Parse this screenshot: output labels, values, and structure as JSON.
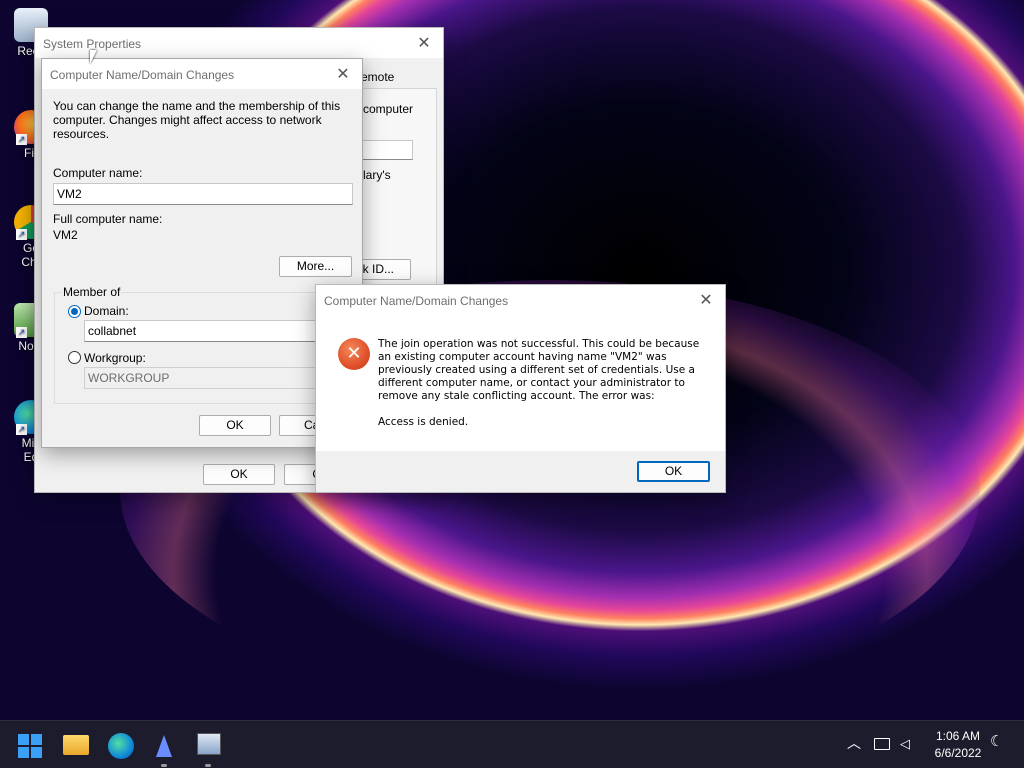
{
  "desktop": {
    "icons": [
      {
        "label": "Recy",
        "icon": "recycle-bin-icon"
      },
      {
        "label": "Fir",
        "icon": "firefox-icon"
      },
      {
        "label": "Go\nChr",
        "icon": "chrome-icon"
      },
      {
        "label": "Note",
        "icon": "notepad-icon"
      },
      {
        "label": "Mic\nEd",
        "icon": "edge-icon"
      }
    ]
  },
  "system_properties": {
    "title": "System Properties",
    "close_glyph": "✕",
    "partial_tab": "emote",
    "partial_text_1": "computer",
    "partial_text_2": "lary's",
    "partial_button": "ork ID...",
    "ok_label": "OK",
    "cancel_label": "Ca"
  },
  "name_changes": {
    "title": "Computer Name/Domain Changes",
    "close_glyph": "✕",
    "intro": "You can change the name and the membership of this computer. Changes might affect access to network resources.",
    "computer_name_label": "Computer name:",
    "computer_name_value": "VM2",
    "full_name_label": "Full computer name:",
    "full_name_value": "VM2",
    "more_label": "More...",
    "member_of_label": "Member of",
    "domain_label": "Domain:",
    "domain_value": "collabnet",
    "domain_selected": true,
    "workgroup_label": "Workgroup:",
    "workgroup_value": "WORKGROUP",
    "ok_label": "OK",
    "cancel_label": "Can"
  },
  "error_dialog": {
    "title": "Computer Name/Domain Changes",
    "close_glyph": "✕",
    "icon": "error-icon",
    "message": "The join operation was not successful. This could be because an existing computer account having name \"VM2\" was previously created using a different set of credentials. Use a different computer name, or contact your administrator to remove any stale conflicting account.  The error was:",
    "detail": "Access is denied.",
    "ok_label": "OK"
  },
  "taskbar": {
    "apps": [
      "start-icon",
      "file-explorer-icon",
      "edge-icon",
      "app-icon",
      "system-properties-icon"
    ],
    "time": "1:06 AM",
    "date": "6/6/2022",
    "colors": {
      "accent": "#0067c0",
      "error": "#e0502a"
    }
  }
}
